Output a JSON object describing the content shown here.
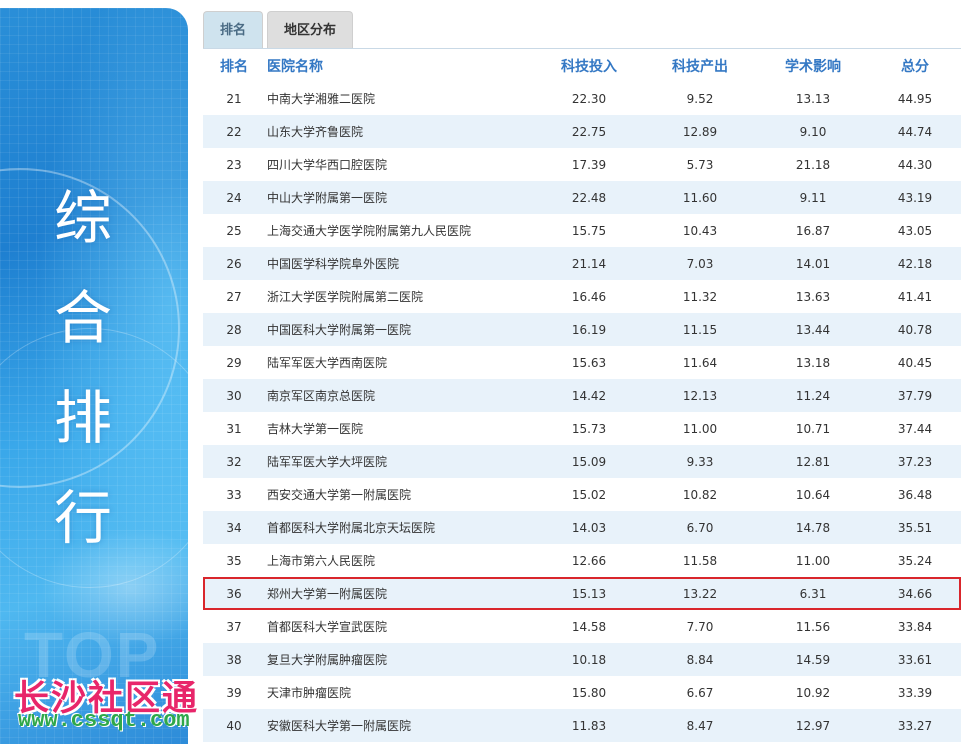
{
  "tabs": [
    {
      "label": "排名",
      "active": true
    },
    {
      "label": "地区分布",
      "active": false
    }
  ],
  "banner": {
    "title_chars": [
      "综",
      "合",
      "排",
      "行"
    ],
    "bg_text": "TOP"
  },
  "watermark": {
    "name": "长沙社区通",
    "url": "www.cssqt.com"
  },
  "table": {
    "headers": {
      "rank": "排名",
      "name": "医院名称",
      "investment": "科技投入",
      "output": "科技产出",
      "academic": "学术影响",
      "total": "总分"
    },
    "highlight_rank": "36",
    "highlight_color": "#d9262c",
    "rows": [
      {
        "rank": "21",
        "name": "中南大学湘雅二医院",
        "investment": "22.30",
        "output": "9.52",
        "academic": "13.13",
        "total": "44.95"
      },
      {
        "rank": "22",
        "name": "山东大学齐鲁医院",
        "investment": "22.75",
        "output": "12.89",
        "academic": "9.10",
        "total": "44.74"
      },
      {
        "rank": "23",
        "name": "四川大学华西口腔医院",
        "investment": "17.39",
        "output": "5.73",
        "academic": "21.18",
        "total": "44.30"
      },
      {
        "rank": "24",
        "name": "中山大学附属第一医院",
        "investment": "22.48",
        "output": "11.60",
        "academic": "9.11",
        "total": "43.19"
      },
      {
        "rank": "25",
        "name": "上海交通大学医学院附属第九人民医院",
        "investment": "15.75",
        "output": "10.43",
        "academic": "16.87",
        "total": "43.05"
      },
      {
        "rank": "26",
        "name": "中国医学科学院阜外医院",
        "investment": "21.14",
        "output": "7.03",
        "academic": "14.01",
        "total": "42.18"
      },
      {
        "rank": "27",
        "name": "浙江大学医学院附属第二医院",
        "investment": "16.46",
        "output": "11.32",
        "academic": "13.63",
        "total": "41.41"
      },
      {
        "rank": "28",
        "name": "中国医科大学附属第一医院",
        "investment": "16.19",
        "output": "11.15",
        "academic": "13.44",
        "total": "40.78"
      },
      {
        "rank": "29",
        "name": "陆军军医大学西南医院",
        "investment": "15.63",
        "output": "11.64",
        "academic": "13.18",
        "total": "40.45"
      },
      {
        "rank": "30",
        "name": "南京军区南京总医院",
        "investment": "14.42",
        "output": "12.13",
        "academic": "11.24",
        "total": "37.79"
      },
      {
        "rank": "31",
        "name": "吉林大学第一医院",
        "investment": "15.73",
        "output": "11.00",
        "academic": "10.71",
        "total": "37.44"
      },
      {
        "rank": "32",
        "name": "陆军军医大学大坪医院",
        "investment": "15.09",
        "output": "9.33",
        "academic": "12.81",
        "total": "37.23"
      },
      {
        "rank": "33",
        "name": "西安交通大学第一附属医院",
        "investment": "15.02",
        "output": "10.82",
        "academic": "10.64",
        "total": "36.48"
      },
      {
        "rank": "34",
        "name": "首都医科大学附属北京天坛医院",
        "investment": "14.03",
        "output": "6.70",
        "academic": "14.78",
        "total": "35.51"
      },
      {
        "rank": "35",
        "name": "上海市第六人民医院",
        "investment": "12.66",
        "output": "11.58",
        "academic": "11.00",
        "total": "35.24"
      },
      {
        "rank": "36",
        "name": "郑州大学第一附属医院",
        "investment": "15.13",
        "output": "13.22",
        "academic": "6.31",
        "total": "34.66"
      },
      {
        "rank": "37",
        "name": "首都医科大学宣武医院",
        "investment": "14.58",
        "output": "7.70",
        "academic": "11.56",
        "total": "33.84"
      },
      {
        "rank": "38",
        "name": "复旦大学附属肿瘤医院",
        "investment": "10.18",
        "output": "8.84",
        "academic": "14.59",
        "total": "33.61"
      },
      {
        "rank": "39",
        "name": "天津市肿瘤医院",
        "investment": "15.80",
        "output": "6.67",
        "academic": "10.92",
        "total": "33.39"
      },
      {
        "rank": "40",
        "name": "安徽医科大学第一附属医院",
        "investment": "11.83",
        "output": "8.47",
        "academic": "12.97",
        "total": "33.27"
      }
    ]
  }
}
